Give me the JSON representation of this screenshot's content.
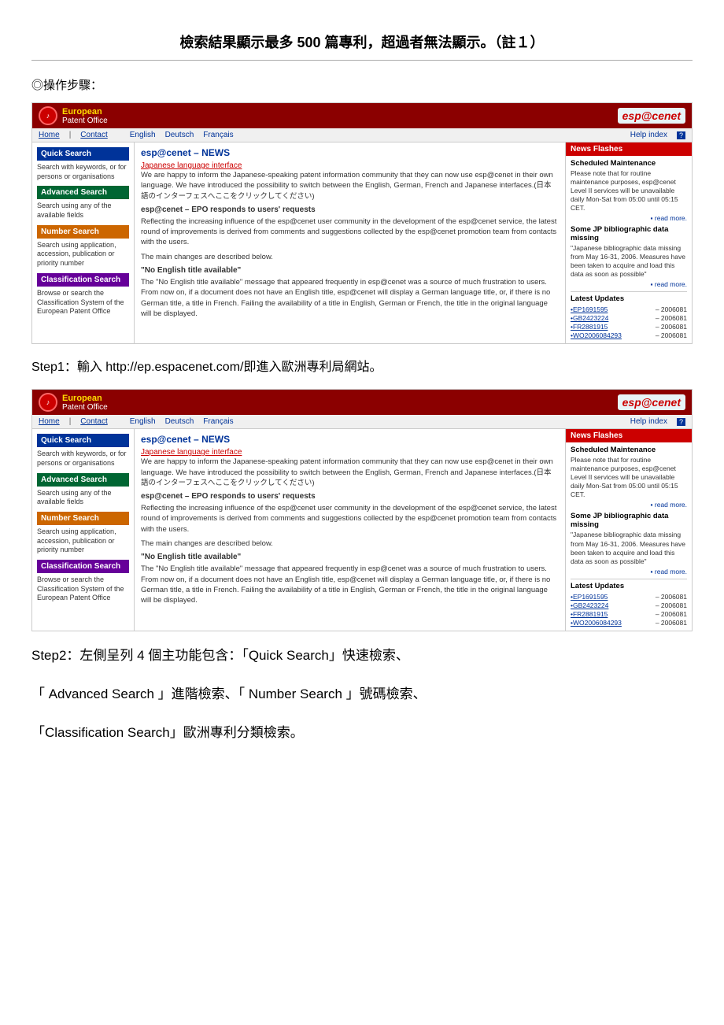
{
  "page": {
    "title": "檢索結果顯示最多 500 篇專利，超過者無法顯示。（註１）",
    "section_label": "◎操作步驟：",
    "step1": "Step1：輸入 http://ep.espacenet.com/即進入歐洲專利局網站。",
    "step2_line1": "Step2：左側呈列 4 個主功能包含：「Quick Search」快速檢索、",
    "step2_line2": "「 Advanced Search 」進階檢索、「 Number Search 」號碼檢索、",
    "step2_line3": "「Classification Search」歐洲專利分類檢索。"
  },
  "epo_header": {
    "logo_text": "♪",
    "org_line1": "European",
    "org_line2": "Patent Office",
    "espacenet_label": "esp@cenet"
  },
  "epo_nav": {
    "items": [
      "Home",
      "Contact"
    ],
    "langs": [
      "English",
      "Deutsch",
      "Français"
    ],
    "help_label": "Help index",
    "help_q": "?"
  },
  "sidebar": {
    "quick_search_label": "Quick Search",
    "quick_search_desc": "Search with keywords, or for persons or organisations",
    "advanced_search_label": "Advanced Search",
    "advanced_search_desc": "Search using any of the available fields",
    "number_search_label": "Number Search",
    "number_search_desc": "Search using application, accession, publication or priority number",
    "classification_search_label": "Classification Search",
    "classification_search_desc": "Browse or search the Classification System of the European Patent Office"
  },
  "main_content": {
    "title": "esp@cenet – NEWS",
    "jp_link": "Japanese language interface",
    "para1": "We are happy to inform the Japanese-speaking patent information community that they can now use esp@cenet in their own language. We have introduced the possibility to switch between the English, German, French and Japanese interfaces.(日本語のインターフェスへここをクリックしてください)",
    "subtitle2": "esp@cenet – EPO responds to users' requests",
    "para2": "Reflecting the increasing influence of the esp@cenet user community in the development of the esp@cenet service, the latest round of improvements is derived from comments and suggestions collected by the esp@cenet promotion team from contacts with the users.",
    "para3": "The main changes are described below.",
    "subtitle3": "\"No English title available\"",
    "para4": "The \"No English title available\" message that appeared frequently in esp@cenet was a source of much frustration to users. From now on, if a document does not have an English title, esp@cenet will display a German language title, or, if there is no German title, a title in French. Failing the availability of a title in English, German or French, the title in the original language will be displayed."
  },
  "news_panel": {
    "header": "News Flashes",
    "section1_title": "Scheduled Maintenance",
    "section1_text": "Please note that for routine maintenance purposes, esp@cenet Level II services will be unavailable daily Mon-Sat from 05:00 until 05:15 CET.",
    "read_more1": "▪ read more.",
    "section2_title": "Some JP bibliographic data missing",
    "section2_text": "\"Japanese bibliographic data missing from May 16-31, 2006. Measures have been taken to acquire and load this data as soon as possible\"",
    "read_more2": "▪ read more.",
    "latest_title": "Latest Updates",
    "updates": [
      {
        "num": "•EP1691595",
        "date": "– 2006081"
      },
      {
        "num": "•GB2423224",
        "date": "– 2006081"
      },
      {
        "num": "•FR2881915",
        "date": "– 2006081"
      },
      {
        "num": "•WO2006084293",
        "date": "– 2006081"
      }
    ]
  }
}
